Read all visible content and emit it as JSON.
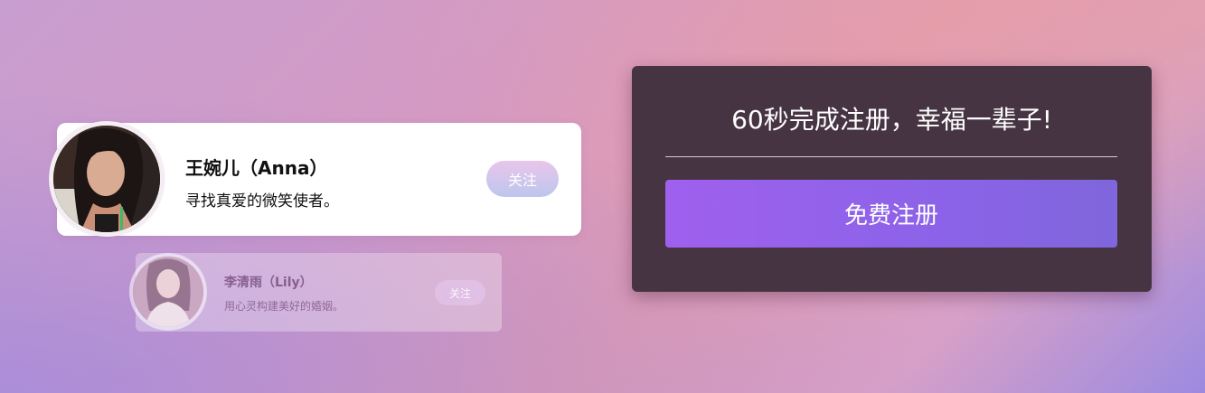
{
  "profiles": [
    {
      "name": "王婉儿（Anna）",
      "bio": "寻找真爱的微笑使者。",
      "follow_label": "关注"
    },
    {
      "name": "李清雨（Lily）",
      "bio": "用心灵构建美好的婚姻。",
      "follow_label": "关注"
    }
  ],
  "register": {
    "title": "60秒完成注册，幸福一辈子!",
    "button_label": "免费注册"
  },
  "colors": {
    "panel_bg": "#473443",
    "button_accent": "#9f60ee",
    "follow_gradient_top": "#e9c5ea",
    "follow_gradient_bottom": "#bcc6ee"
  }
}
